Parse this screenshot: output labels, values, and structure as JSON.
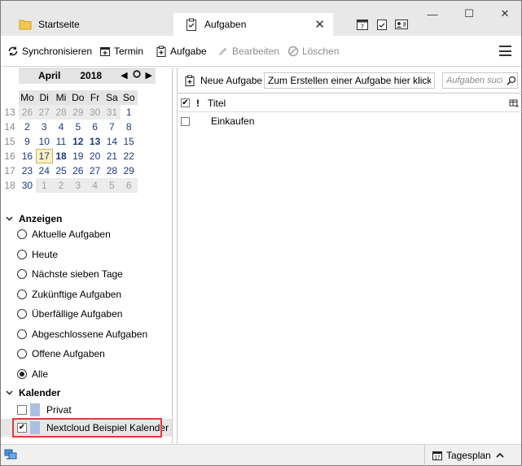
{
  "tabs": {
    "home": {
      "label": "Startseite"
    },
    "tasks": {
      "label": "Aufgaben",
      "close": "✕"
    }
  },
  "window_controls": {
    "minimize": "—",
    "maximize": "☐",
    "close": "✕"
  },
  "toolbar": {
    "sync": "Synchronisieren",
    "event": "Termin",
    "task": "Aufgabe",
    "edit": "Bearbeiten",
    "delete": "Löschen"
  },
  "minical": {
    "month": "April",
    "year": "2018",
    "weekdays": [
      "Mo",
      "Di",
      "Mi",
      "Do",
      "Fr",
      "Sa",
      "So"
    ],
    "weeks": [
      {
        "wk": "13",
        "days": [
          [
            "26",
            "o"
          ],
          [
            "27",
            "o"
          ],
          [
            "28",
            "o"
          ],
          [
            "29",
            "o"
          ],
          [
            "30",
            "o"
          ],
          [
            "31",
            "o"
          ],
          [
            "1",
            "c"
          ]
        ]
      },
      {
        "wk": "14",
        "days": [
          [
            "2",
            "c"
          ],
          [
            "3",
            "c"
          ],
          [
            "4",
            "c"
          ],
          [
            "5",
            "c"
          ],
          [
            "6",
            "c"
          ],
          [
            "7",
            "c"
          ],
          [
            "8",
            "c"
          ]
        ]
      },
      {
        "wk": "15",
        "days": [
          [
            "9",
            "c"
          ],
          [
            "10",
            "c"
          ],
          [
            "11",
            "c"
          ],
          [
            "12",
            "b"
          ],
          [
            "13",
            "b"
          ],
          [
            "14",
            "c"
          ],
          [
            "15",
            "c"
          ]
        ]
      },
      {
        "wk": "16",
        "days": [
          [
            "16",
            "c"
          ],
          [
            "17",
            "t"
          ],
          [
            "18",
            "b"
          ],
          [
            "19",
            "c"
          ],
          [
            "20",
            "c"
          ],
          [
            "21",
            "c"
          ],
          [
            "22",
            "c"
          ]
        ]
      },
      {
        "wk": "17",
        "days": [
          [
            "23",
            "c"
          ],
          [
            "24",
            "c"
          ],
          [
            "25",
            "c"
          ],
          [
            "26",
            "c"
          ],
          [
            "27",
            "c"
          ],
          [
            "28",
            "c"
          ],
          [
            "29",
            "c"
          ]
        ]
      },
      {
        "wk": "18",
        "days": [
          [
            "30",
            "c"
          ],
          [
            "1",
            "o"
          ],
          [
            "2",
            "o"
          ],
          [
            "3",
            "o"
          ],
          [
            "4",
            "o"
          ],
          [
            "5",
            "o"
          ],
          [
            "6",
            "o"
          ]
        ]
      }
    ]
  },
  "filter": {
    "title": "Anzeigen",
    "options": [
      {
        "label": "Aktuelle Aufgaben",
        "selected": false
      },
      {
        "label": "Heute",
        "selected": false
      },
      {
        "label": "Nächste sieben Tage",
        "selected": false
      },
      {
        "label": "Zukünftige Aufgaben",
        "selected": false
      },
      {
        "label": "Überfällige Aufgaben",
        "selected": false
      },
      {
        "label": "Abgeschlossene Aufgaben",
        "selected": false
      },
      {
        "label": "Offene Aufgaben",
        "selected": false
      },
      {
        "label": "Alle",
        "selected": true
      }
    ]
  },
  "calendars": {
    "title": "Kalender",
    "items": [
      {
        "label": "Privat",
        "checked": false,
        "color": "#a9c0e0"
      },
      {
        "label": "Nextcloud Beispiel Kalender",
        "checked": true,
        "color": "#a9c0e0"
      }
    ]
  },
  "tasks_pane": {
    "new_task": "Neue Aufgabe",
    "quick_add": "Zum Erstellen einer Aufgabe hier klicken",
    "search_placeholder": "Aufgaben suchen",
    "columns": {
      "priority": "!",
      "title": "Titel"
    },
    "rows": [
      {
        "title": "Einkaufen",
        "done": false
      }
    ]
  },
  "statusbar": {
    "dayplan": "Tagesplan"
  },
  "colors": {
    "highlight": "#e03c3c",
    "today_bg": "#fbf0c0",
    "calendar_swatch": "#a9c0e0"
  }
}
